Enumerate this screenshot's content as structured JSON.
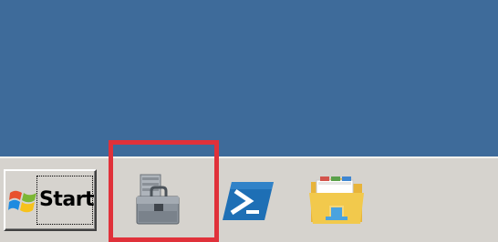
{
  "taskbar": {
    "start_label": "Start",
    "pinned_icons": [
      {
        "name": "server-manager-icon",
        "highlighted": true
      },
      {
        "name": "powershell-icon",
        "highlighted": false
      },
      {
        "name": "file-explorer-icon",
        "highlighted": false
      }
    ]
  },
  "colors": {
    "desktop": "#3e6b9a",
    "taskbar": "#d6d3ce",
    "highlight": "#e0313a",
    "powershell": "#1e6fb5",
    "folder": "#f2c94c"
  }
}
